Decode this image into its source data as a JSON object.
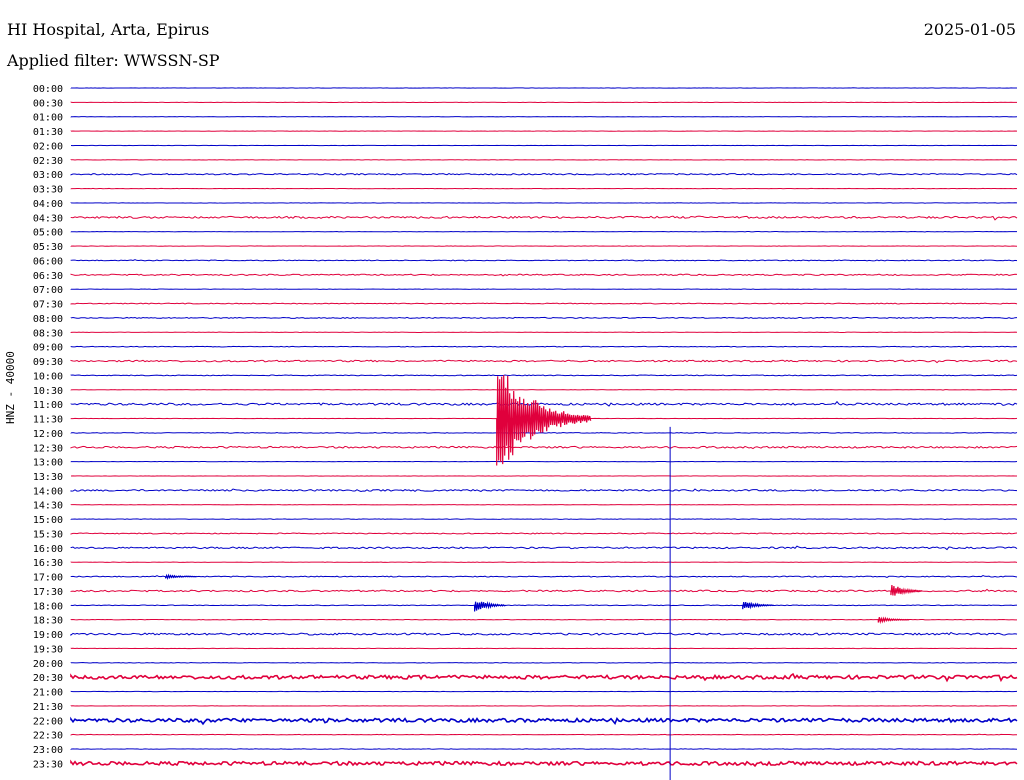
{
  "header": {
    "title": "HI Hospital, Arta, Epirus",
    "date": "2025-01-05",
    "filter": "Applied filter: WWSSN-SP"
  },
  "chart_data": {
    "type": "line",
    "subtype": "helicorder",
    "ylabel": "HNZ - 40000",
    "row_interval_minutes": 30,
    "tick_labels": [
      "00:00",
      "00:30",
      "01:00",
      "01:30",
      "02:00",
      "02:30",
      "03:00",
      "03:30",
      "04:00",
      "04:30",
      "05:00",
      "05:30",
      "06:00",
      "06:30",
      "07:00",
      "07:30",
      "08:00",
      "08:30",
      "09:00",
      "09:30",
      "10:00",
      "10:30",
      "11:00",
      "11:30",
      "12:00",
      "12:30",
      "13:00",
      "13:30",
      "14:00",
      "14:30",
      "15:00",
      "15:30",
      "16:00",
      "16:30",
      "17:00",
      "17:30",
      "18:00",
      "18:30",
      "19:00",
      "19:30",
      "20:00",
      "20:30",
      "21:00",
      "21:30",
      "22:00",
      "22:30",
      "23:00",
      "23:30"
    ],
    "colors": {
      "even_rows": "#0000c8",
      "odd_rows": "#e0003c",
      "marker": "#0000c8"
    },
    "row_noise_level": [
      0.2,
      0.2,
      0.2,
      0.2,
      0.2,
      0.2,
      0.8,
      0.2,
      0.2,
      1.2,
      0.2,
      0.2,
      0.5,
      0.8,
      0.2,
      0.5,
      0.6,
      0.2,
      0.4,
      1.0,
      0.5,
      0.2,
      1.3,
      0.2,
      0.4,
      1.1,
      0.2,
      0.2,
      1.0,
      0.2,
      0.3,
      0.6,
      1.0,
      0.2,
      0.6,
      1.0,
      0.4,
      0.3,
      1.2,
      0.2,
      0.3,
      2.2,
      0.2,
      0.2,
      2.2,
      0.3,
      0.3,
      2.2
    ],
    "events": [
      {
        "row": 23,
        "minute": 13.5,
        "amplitude": 60,
        "duration_min": 3
      },
      {
        "row": 35,
        "minute": 26.0,
        "amplitude": 8,
        "duration_min": 1
      },
      {
        "row": 36,
        "minute": 12.8,
        "amplitude": 7,
        "duration_min": 1
      },
      {
        "row": 36,
        "minute": 21.3,
        "amplitude": 5,
        "duration_min": 1
      },
      {
        "row": 37,
        "minute": 25.6,
        "amplitude": 3,
        "duration_min": 1
      },
      {
        "row": 34,
        "minute": 3.0,
        "amplitude": 2,
        "duration_min": 1
      }
    ],
    "vertical_marker_minute": 19.0,
    "ylim_minutes": [
      0,
      30
    ]
  }
}
